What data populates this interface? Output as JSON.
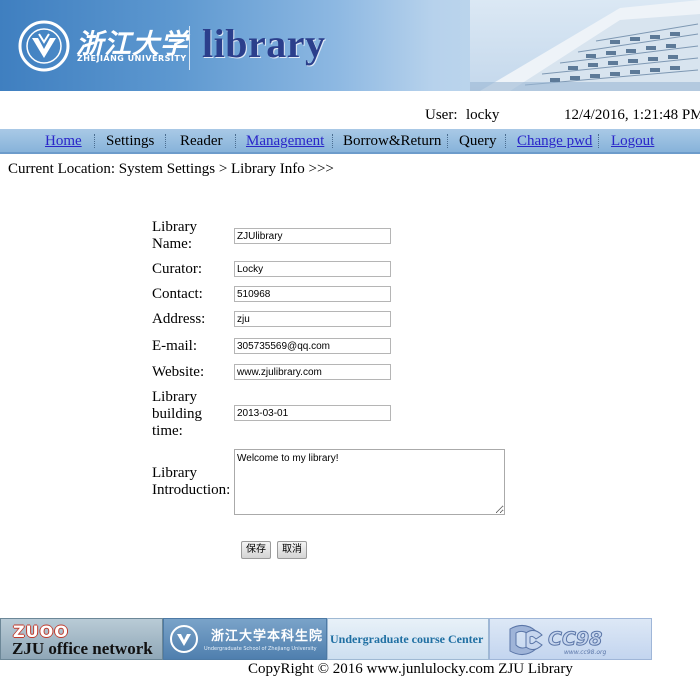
{
  "header": {
    "logo_cn": "浙江大学",
    "logo_en": "ZHEJIANG UNIVERSITY",
    "app_title": "library"
  },
  "user_bar": {
    "user_label": "User:",
    "username": "locky",
    "datetime": "12/4/2016, 1:21:48 PM"
  },
  "nav": [
    {
      "label": "Home",
      "is_link": true
    },
    {
      "label": "Settings",
      "is_link": false
    },
    {
      "label": "Reader",
      "is_link": false
    },
    {
      "label": "Management",
      "is_link": true
    },
    {
      "label": "Borrow&Return",
      "is_link": false
    },
    {
      "label": "Query",
      "is_link": false
    },
    {
      "label": "Change pwd",
      "is_link": true
    },
    {
      "label": "Logout",
      "is_link": true
    }
  ],
  "breadcrumb": "Current Location: System Settings > Library Info >>>",
  "form": {
    "library_name": {
      "label_line1": "Library",
      "label_line2": "Name:",
      "value": "ZJUlibrary"
    },
    "curator": {
      "label": "Curator:",
      "value": "Locky"
    },
    "contact": {
      "label": "Contact:",
      "value": "510968"
    },
    "address": {
      "label": "Address:",
      "value": "zju"
    },
    "email": {
      "label": "E-mail:",
      "value": "305735569@qq.com"
    },
    "website": {
      "label": "Website:",
      "value": "www.zjulibrary.com"
    },
    "building_time": {
      "label_line1": "Library",
      "label_line2": "building",
      "label_line3": "time:",
      "value": "2013-03-01"
    },
    "introduction": {
      "label_line1": "Library",
      "label_line2": "Introduction:",
      "value": "Welcome to my library!"
    },
    "save_label": "保存",
    "cancel_label": "取消"
  },
  "footer_links": {
    "zuoo": "ZUOO",
    "zju_office": "ZJU office network",
    "undergrad_cn": "浙江大学本科生院",
    "undergrad_en": "Undergraduate School of Zhejiang University",
    "course_center": "Undergraduate course Center",
    "cc98_name": "CC98",
    "cc98_url": "www.cc98.org"
  },
  "copyright": "CopyRight © 2016 www.junlulocky.com   ZJU Library",
  "colors": {
    "nav_bg": "#96bde0",
    "link": "#2a25c9",
    "library_title": "#2b3f8c"
  }
}
